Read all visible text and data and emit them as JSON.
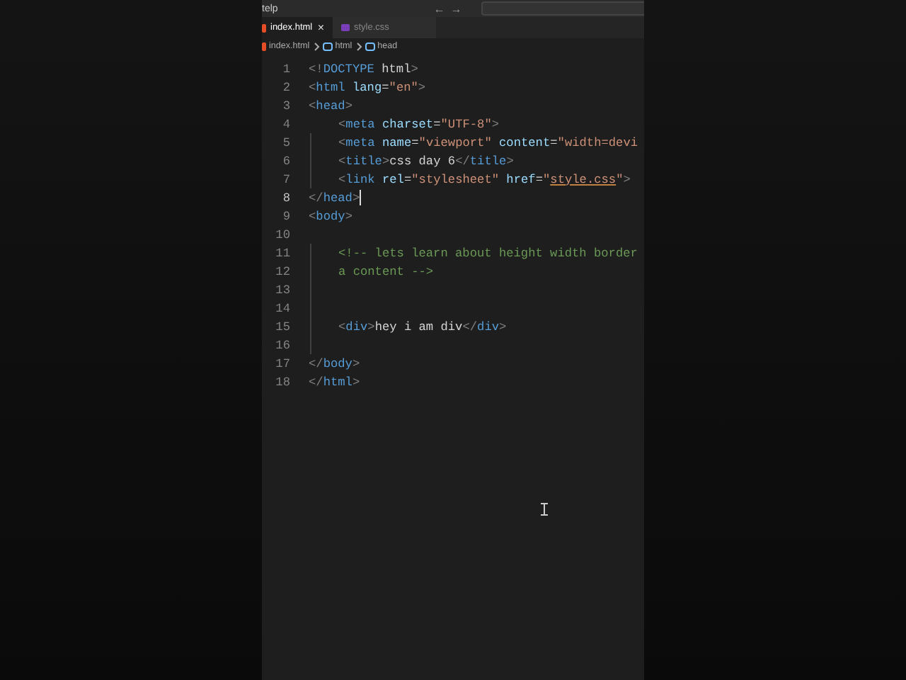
{
  "title_bar": {
    "menu": "telp",
    "back": "←",
    "forward": "→"
  },
  "tabs": [
    {
      "label": "index.html",
      "selected": true,
      "kind": "html",
      "close": "×"
    },
    {
      "label": "style.css",
      "selected": false,
      "kind": "css"
    }
  ],
  "breadcrumb": [
    "index.html",
    "html",
    "head"
  ],
  "lines": [
    {
      "number": "1",
      "active": false,
      "cursor": false,
      "tokens": [
        {
          "kind": "punct",
          "text": "<!"
        },
        {
          "kind": "tag",
          "text": "DOCTYPE"
        },
        {
          "kind": "text",
          "text": " html"
        },
        {
          "kind": "punct",
          "text": ">"
        }
      ]
    },
    {
      "number": "2",
      "active": false,
      "cursor": false,
      "tokens": [
        {
          "kind": "punct",
          "text": "<"
        },
        {
          "kind": "tag",
          "text": "html"
        },
        {
          "kind": "attr",
          "text": " lang"
        },
        {
          "kind": "text",
          "text": "="
        },
        {
          "kind": "string",
          "text": "\"en\""
        },
        {
          "kind": "punct",
          "text": ">"
        }
      ]
    },
    {
      "number": "3",
      "active": false,
      "cursor": false,
      "tokens": [
        {
          "kind": "punct",
          "text": "<"
        },
        {
          "kind": "tag",
          "text": "head"
        },
        {
          "kind": "punct",
          "text": ">"
        }
      ],
      "children": [
        {
          "number": "4",
          "active": false,
          "cursor": false,
          "tokens": [
            {
              "kind": "punct",
              "text": "<"
            },
            {
              "kind": "tag",
              "text": "meta"
            },
            {
              "kind": "attr",
              "text": " charset"
            },
            {
              "kind": "text",
              "text": "="
            },
            {
              "kind": "string",
              "text": "\"UTF-8\""
            },
            {
              "kind": "punct",
              "text": ">"
            }
          ]
        },
        {
          "number": "5",
          "active": false,
          "cursor": false,
          "tokens": [
            {
              "kind": "punct",
              "text": "<"
            },
            {
              "kind": "tag",
              "text": "meta"
            },
            {
              "kind": "attr",
              "text": " name"
            },
            {
              "kind": "text",
              "text": "="
            },
            {
              "kind": "string",
              "text": "\"viewport\""
            },
            {
              "kind": "attr",
              "text": " content"
            },
            {
              "kind": "text",
              "text": "="
            },
            {
              "kind": "string",
              "text": "\"width=devi"
            }
          ]
        },
        {
          "number": "6",
          "active": false,
          "cursor": false,
          "tokens": [
            {
              "kind": "punct",
              "text": "<"
            },
            {
              "kind": "tag",
              "text": "title"
            },
            {
              "kind": "punct",
              "text": ">"
            },
            {
              "kind": "text",
              "text": "css day 6"
            },
            {
              "kind": "punct",
              "text": "</"
            },
            {
              "kind": "tag",
              "text": "title"
            },
            {
              "kind": "punct",
              "text": ">"
            }
          ]
        },
        {
          "number": "7",
          "active": false,
          "cursor": false,
          "tokens": [
            {
              "kind": "punct",
              "text": "<"
            },
            {
              "kind": "tag",
              "text": "link"
            },
            {
              "kind": "attr",
              "text": " rel"
            },
            {
              "kind": "text",
              "text": "="
            },
            {
              "kind": "string",
              "text": "\"stylesheet\""
            },
            {
              "kind": "attr",
              "text": " href"
            },
            {
              "kind": "text",
              "text": "="
            },
            {
              "kind": "string",
              "text": "\""
            },
            {
              "kind": "link",
              "text": "style.css"
            },
            {
              "kind": "string",
              "text": "\""
            },
            {
              "kind": "punct",
              "text": ">"
            }
          ]
        }
      ]
    },
    {
      "number": "8",
      "active": true,
      "cursor": true,
      "tokens": [
        {
          "kind": "punct",
          "text": "</"
        },
        {
          "kind": "tag",
          "text": "head"
        },
        {
          "kind": "punct",
          "text": ">"
        }
      ]
    },
    {
      "number": "9",
      "active": false,
      "cursor": false,
      "tokens": [
        {
          "kind": "punct",
          "text": "<"
        },
        {
          "kind": "tag",
          "text": "body"
        },
        {
          "kind": "punct",
          "text": ">"
        }
      ],
      "children": [
        {
          "number": "10",
          "active": false
        },
        {
          "number": "11",
          "active": false,
          "cursor": false,
          "tokens": [
            {
              "kind": "comment",
              "text": "<!-- lets learn about height width border"
            }
          ]
        },
        {
          "number": "12",
          "active": false,
          "cursor": false,
          "tokens": [
            {
              "kind": "comment",
              "text": "a content -->"
            }
          ]
        },
        {
          "number": "13",
          "active": false
        },
        {
          "number": "14",
          "active": false
        },
        {
          "number": "15",
          "active": false,
          "cursor": false,
          "tokens": [
            {
              "kind": "punct",
              "text": "<"
            },
            {
              "kind": "tag",
              "text": "div"
            },
            {
              "kind": "punct",
              "text": ">"
            },
            {
              "kind": "text",
              "text": "hey i am div"
            },
            {
              "kind": "punct",
              "text": "</"
            },
            {
              "kind": "tag",
              "text": "div"
            },
            {
              "kind": "punct",
              "text": ">"
            }
          ]
        },
        {
          "number": "16",
          "active": false
        }
      ]
    },
    {
      "number": "17",
      "active": false,
      "cursor": false,
      "tokens": [
        {
          "kind": "punct",
          "text": "</"
        },
        {
          "kind": "tag",
          "text": "body"
        },
        {
          "kind": "punct",
          "text": ">"
        }
      ]
    },
    {
      "number": "18",
      "active": false,
      "cursor": false,
      "tokens": [
        {
          "kind": "punct",
          "text": "</"
        },
        {
          "kind": "tag",
          "text": "html"
        },
        {
          "kind": "punct",
          "text": ">"
        }
      ]
    }
  ]
}
